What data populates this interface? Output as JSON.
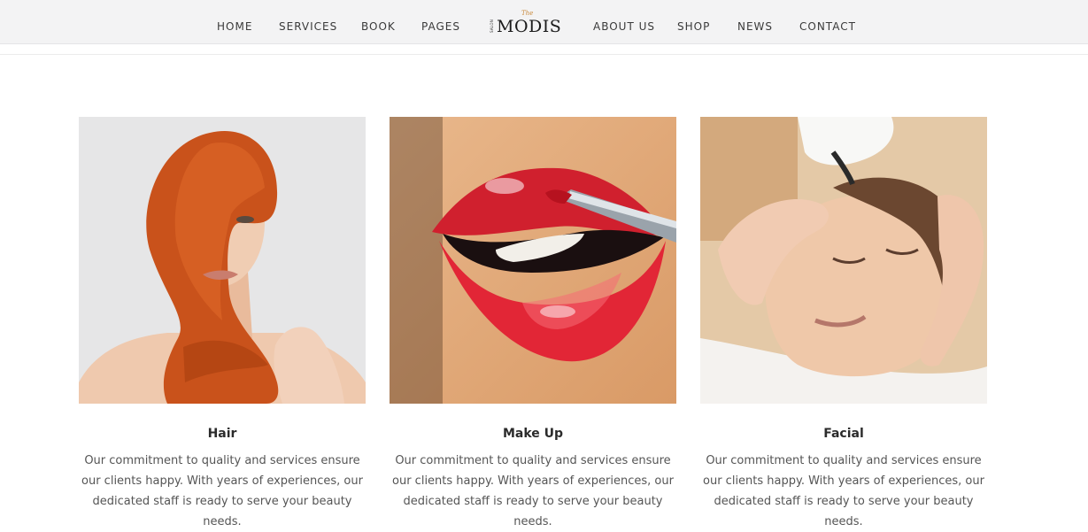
{
  "nav": {
    "left": [
      "HOME",
      "SERVICES",
      "BOOK",
      "PAGES"
    ],
    "right": [
      "ABOUT US",
      "SHOP",
      "NEWS",
      "CONTACT"
    ]
  },
  "logo": {
    "the": "The",
    "salon": "SALON",
    "name": "MODIS"
  },
  "services": [
    {
      "title": "Hair",
      "image": "hair-model-photo",
      "description": "Our commitment to quality and services ensure our clients happy. With years of experiences, our dedicated staff is ready to serve your beauty needs."
    },
    {
      "title": "Make Up",
      "image": "lipstick-photo",
      "description": "Our commitment to quality and services ensure our clients happy. With years of experiences, our dedicated staff is ready to serve your beauty needs."
    },
    {
      "title": "Facial",
      "image": "facial-massage-photo",
      "description": "Our commitment to quality and services ensure our clients happy. With years of experiences, our dedicated staff is ready to serve your beauty needs."
    }
  ]
}
